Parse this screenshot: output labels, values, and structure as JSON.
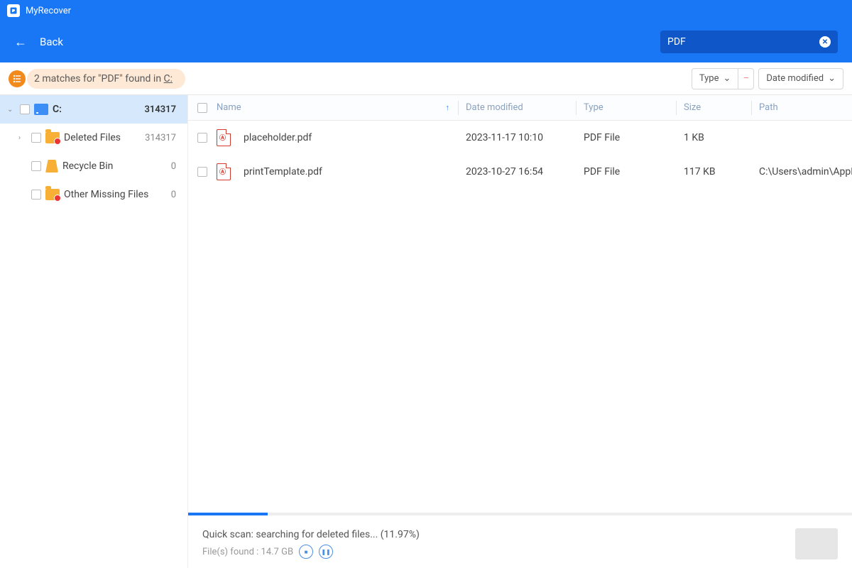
{
  "app": {
    "name": "MyRecover"
  },
  "header": {
    "back_label": "Back"
  },
  "search": {
    "value": "PDF"
  },
  "match": {
    "text_a": "2 matches for \"PDF\" found in ",
    "drive": "C:"
  },
  "filters": {
    "type_label": "Type",
    "date_label": "Date modified"
  },
  "sidebar": {
    "items": [
      {
        "label": "C:",
        "count": "314317"
      },
      {
        "label": "Deleted Files",
        "count": "314317"
      },
      {
        "label": "Recycle Bin",
        "count": "0"
      },
      {
        "label": "Other Missing Files",
        "count": "0"
      }
    ]
  },
  "columns": {
    "name": "Name",
    "date": "Date modified",
    "type": "Type",
    "size": "Size",
    "path": "Path"
  },
  "rows": [
    {
      "name": "placeholder.pdf",
      "date": "2023-11-17 10:10",
      "type": "PDF File",
      "size": "1 KB",
      "path": ""
    },
    {
      "name": "printTemplate.pdf",
      "date": "2023-10-27 16:54",
      "type": "PDF File",
      "size": "117 KB",
      "path": "C:\\Users\\admin\\AppData\\Roami"
    }
  ],
  "progress": {
    "percent": 11.97
  },
  "status": {
    "line1": "Quick scan: searching for deleted files... (11.97%)",
    "line2": "File(s) found : 14.7 GB"
  }
}
